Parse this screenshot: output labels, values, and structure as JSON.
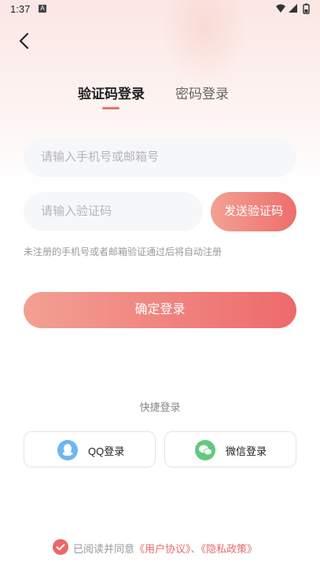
{
  "status_bar": {
    "time": "1:37",
    "notification_glyph": "A"
  },
  "tabs": [
    {
      "label": "验证码登录",
      "active": true
    },
    {
      "label": "密码登录",
      "active": false
    }
  ],
  "form": {
    "phone_placeholder": "请输入手机号或邮箱号",
    "code_placeholder": "请输入验证码",
    "send_code_label": "发送验证码",
    "hint": "未注册的手机号或者邮箱验证通过后将自动注册",
    "login_label": "确定登录"
  },
  "quick_login": {
    "title": "快捷登录",
    "qq_label": "QQ登录",
    "wechat_label": "微信登录"
  },
  "agreement": {
    "checked": true,
    "prefix": "已阅读并同意",
    "user_agreement": "《用户协议》",
    "separator": "、",
    "privacy_policy": "《隐私政策》"
  },
  "colors": {
    "accent": "#ee6e6c",
    "accent_light": "#f2a193",
    "qq": "#6ab7f3",
    "wechat": "#62c97e"
  },
  "icons": {
    "back": "back-arrow-icon",
    "qq": "qq-icon",
    "wechat": "wechat-icon",
    "check": "check-icon"
  }
}
